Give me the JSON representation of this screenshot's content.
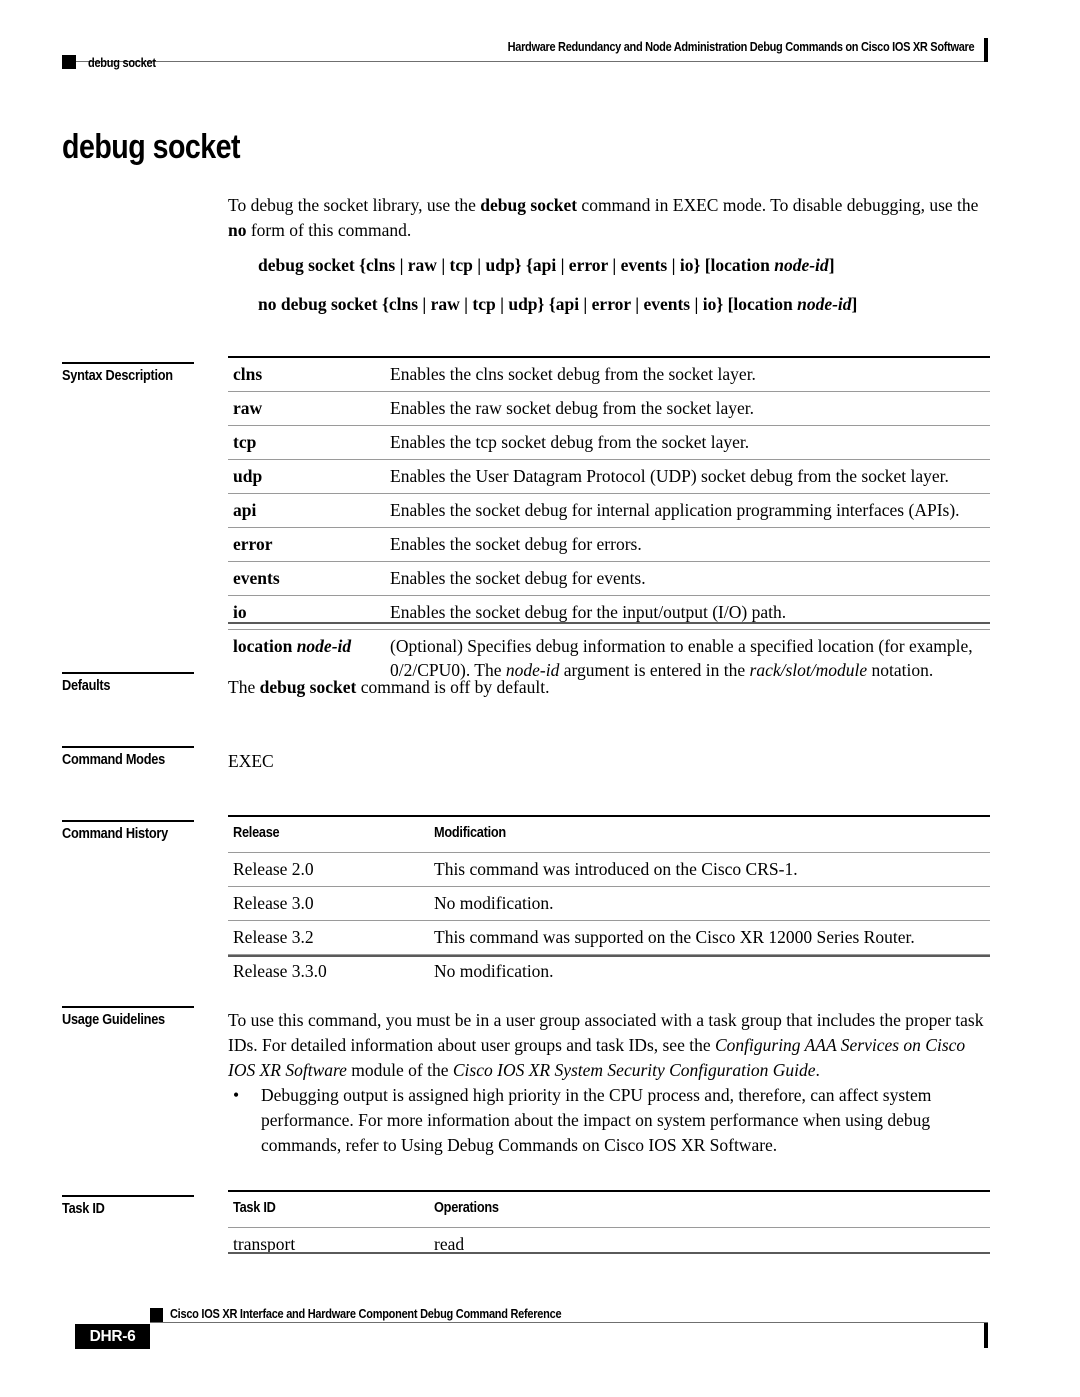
{
  "header": {
    "chapter_marker": "square-marker",
    "chapter_label": "debug socket",
    "book_title": "Hardware Redundancy and Node Administration Debug Commands on Cisco IOS XR Software"
  },
  "title": "debug socket",
  "intro": {
    "text_1": "To debug the socket library, use the ",
    "bold_1": "debug socket",
    "text_2": " command in EXEC mode. To disable debugging, use the ",
    "bold_2": "no",
    "text_3": " form of this command."
  },
  "syntax_lines": [
    {
      "bold": "debug socket {clns | raw | tcp | udp} {api | error | events | io} [location ",
      "italic": "node-id",
      "tail": "]"
    },
    {
      "bold": "no debug socket {clns | raw | tcp | udp} {api | error | events | io} [location ",
      "italic": "node-id",
      "tail": "]"
    }
  ],
  "sections": {
    "syntax_description": "Syntax Description",
    "defaults": "Defaults",
    "command_modes": "Command Modes",
    "command_history": "Command History",
    "usage_guidelines": "Usage Guidelines",
    "task_id": "Task ID"
  },
  "syntax_description_rows": [
    {
      "term": "clns",
      "desc": "Enables the clns socket debug from the socket layer."
    },
    {
      "term": "raw",
      "desc": "Enables the raw socket debug from the socket layer."
    },
    {
      "term": "tcp",
      "desc": "Enables the tcp socket debug from the socket layer."
    },
    {
      "term": "udp",
      "desc": "Enables the User Datagram Protocol (UDP) socket debug from the socket layer."
    },
    {
      "term": "api",
      "desc": "Enables the socket debug for internal application programming interfaces (APIs)."
    },
    {
      "term": "error",
      "desc": "Enables the socket debug for errors."
    },
    {
      "term": "events",
      "desc": "Enables the socket debug for events."
    },
    {
      "term": "io",
      "desc": "Enables the socket debug for the input/output (I/O) path."
    }
  ],
  "syntax_description_location": {
    "term_bold": "location ",
    "term_italic": "node-id",
    "desc_1": "(Optional) Specifies debug information to enable a specified location (for example, 0/2/CPU0). The ",
    "desc_italic_1": "node-id",
    "desc_2": " argument is entered in the ",
    "desc_italic_2": "rack/slot/module",
    "desc_3": " notation."
  },
  "defaults": {
    "text_1": "The ",
    "bold_1": "debug socket",
    "text_2": " command is off by default."
  },
  "command_modes_value": "EXEC",
  "command_history": {
    "headers": [
      "Release",
      "Modification"
    ],
    "rows": [
      [
        "Release 2.0",
        "This command was introduced on the Cisco CRS-1."
      ],
      [
        "Release 3.0",
        "No modification."
      ],
      [
        "Release 3.2",
        "This command was supported on the Cisco XR 12000 Series Router."
      ],
      [
        "Release 3.3.0",
        "No modification."
      ]
    ]
  },
  "usage_guidelines": {
    "para_1": "To use this command, you must be in a user group associated with a task group that includes the proper task IDs. For detailed information about user groups and task IDs, see the ",
    "para_1_italic_1": "Configuring AAA Services on Cisco IOS XR Software",
    "para_1_mid": " module of the ",
    "para_1_italic_2": "Cisco IOS XR System Security Configuration Guide",
    "para_1_end": ".",
    "bullet_char": "•",
    "bullet_1": "Debugging output is assigned high priority in the CPU process and, therefore, can affect system performance. For more information about the impact on system performance when using debug commands, refer to Using Debug Commands on Cisco IOS XR Software."
  },
  "task_id_table": {
    "headers": [
      "Task ID",
      "Operations"
    ],
    "rows": [
      [
        "transport",
        "read"
      ]
    ]
  },
  "footer": {
    "doc_title": "Cisco IOS XR Interface and Hardware Component Debug Command Reference",
    "page_number": "DHR-6"
  }
}
